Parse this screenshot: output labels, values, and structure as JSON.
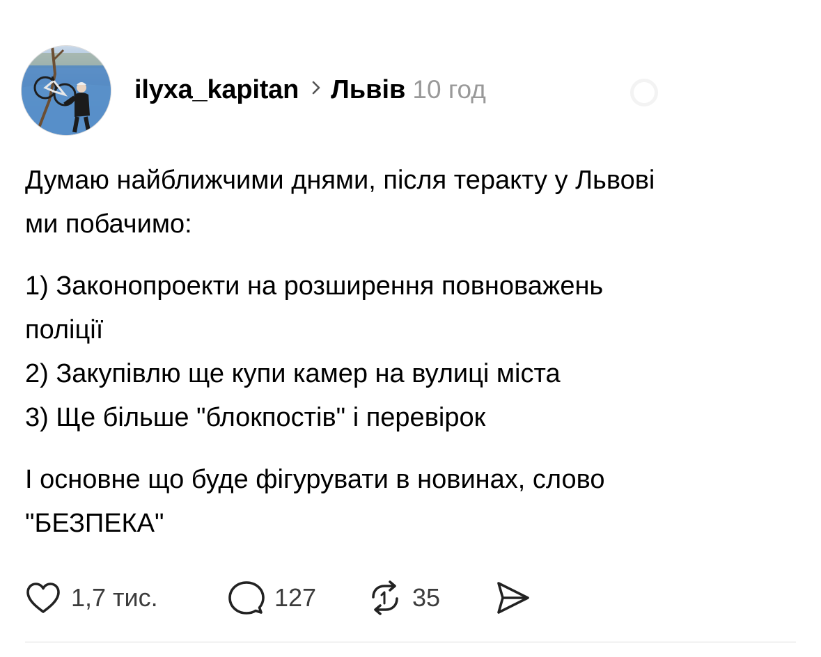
{
  "post": {
    "author": {
      "username": "ilyxa_kapitan",
      "avatar_icon": "avatar-photo-cyclist-on-ice"
    },
    "location": "Львів",
    "time_ago": "10 год",
    "body": {
      "intro_line1": "Думаю найближчими днями, після теракту у Львові",
      "intro_line2": "ми побачимо:",
      "item1_line1": "1) Законопроекти на розширення повноважень",
      "item1_line2": "поліції",
      "item2": "2) Закупівлю ще купи камер на вулиці міста",
      "item3": "3) Ще більше \"блокпостів\" і перевірок",
      "outro_line1": "І основне що буде фігурувати в новинах, слово",
      "outro_line2": "\"БЕЗПЕКА\""
    },
    "actions": {
      "likes": "1,7 тис.",
      "comments": "127",
      "reposts": "35"
    },
    "colors": {
      "text": "#000000",
      "muted": "#999999",
      "count": "#3c3c3c",
      "divider": "#dcdcdc"
    }
  }
}
